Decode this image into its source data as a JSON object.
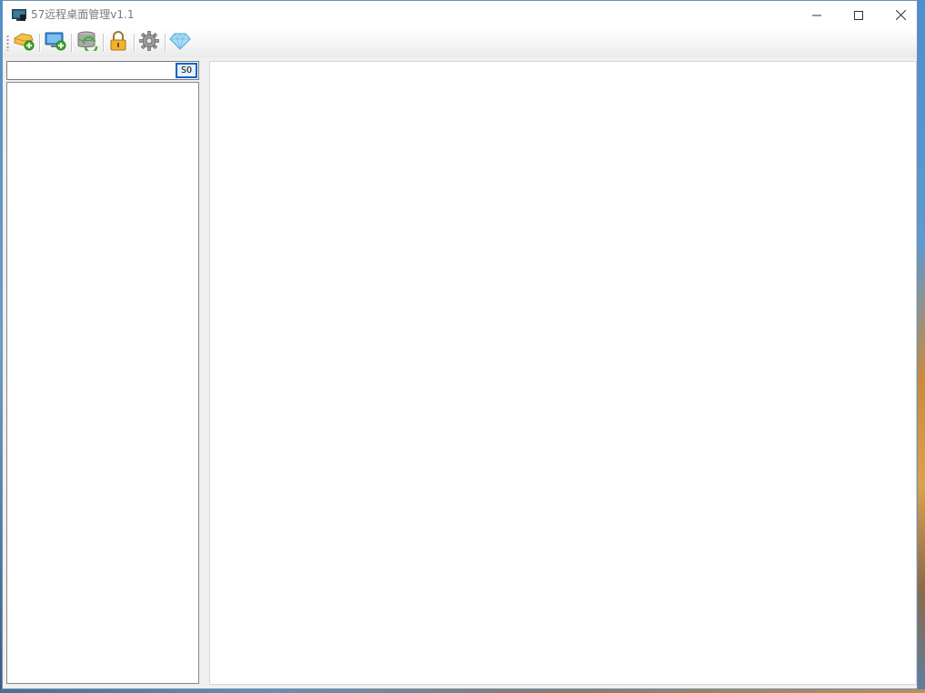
{
  "window": {
    "title": "57远程桌面管理v1.1",
    "controls": {
      "minimize_icon": "minimize-icon",
      "maximize_icon": "maximize-icon",
      "close_icon": "close-icon"
    }
  },
  "toolbar": {
    "buttons": [
      {
        "id": "add-group",
        "icon": "folder-add-icon"
      },
      {
        "id": "add-remote",
        "icon": "monitor-add-icon"
      },
      {
        "id": "refresh-data",
        "icon": "database-refresh-icon"
      },
      {
        "id": "lock",
        "icon": "lock-icon"
      },
      {
        "id": "settings",
        "icon": "gear-icon"
      },
      {
        "id": "vip",
        "icon": "diamond-icon"
      }
    ]
  },
  "search": {
    "value": "",
    "placeholder": "",
    "button_label": "SO"
  },
  "colors": {
    "accent": "#0a64c8",
    "panel_bg": "#ffffff",
    "window_bg": "#f0f0f0"
  }
}
